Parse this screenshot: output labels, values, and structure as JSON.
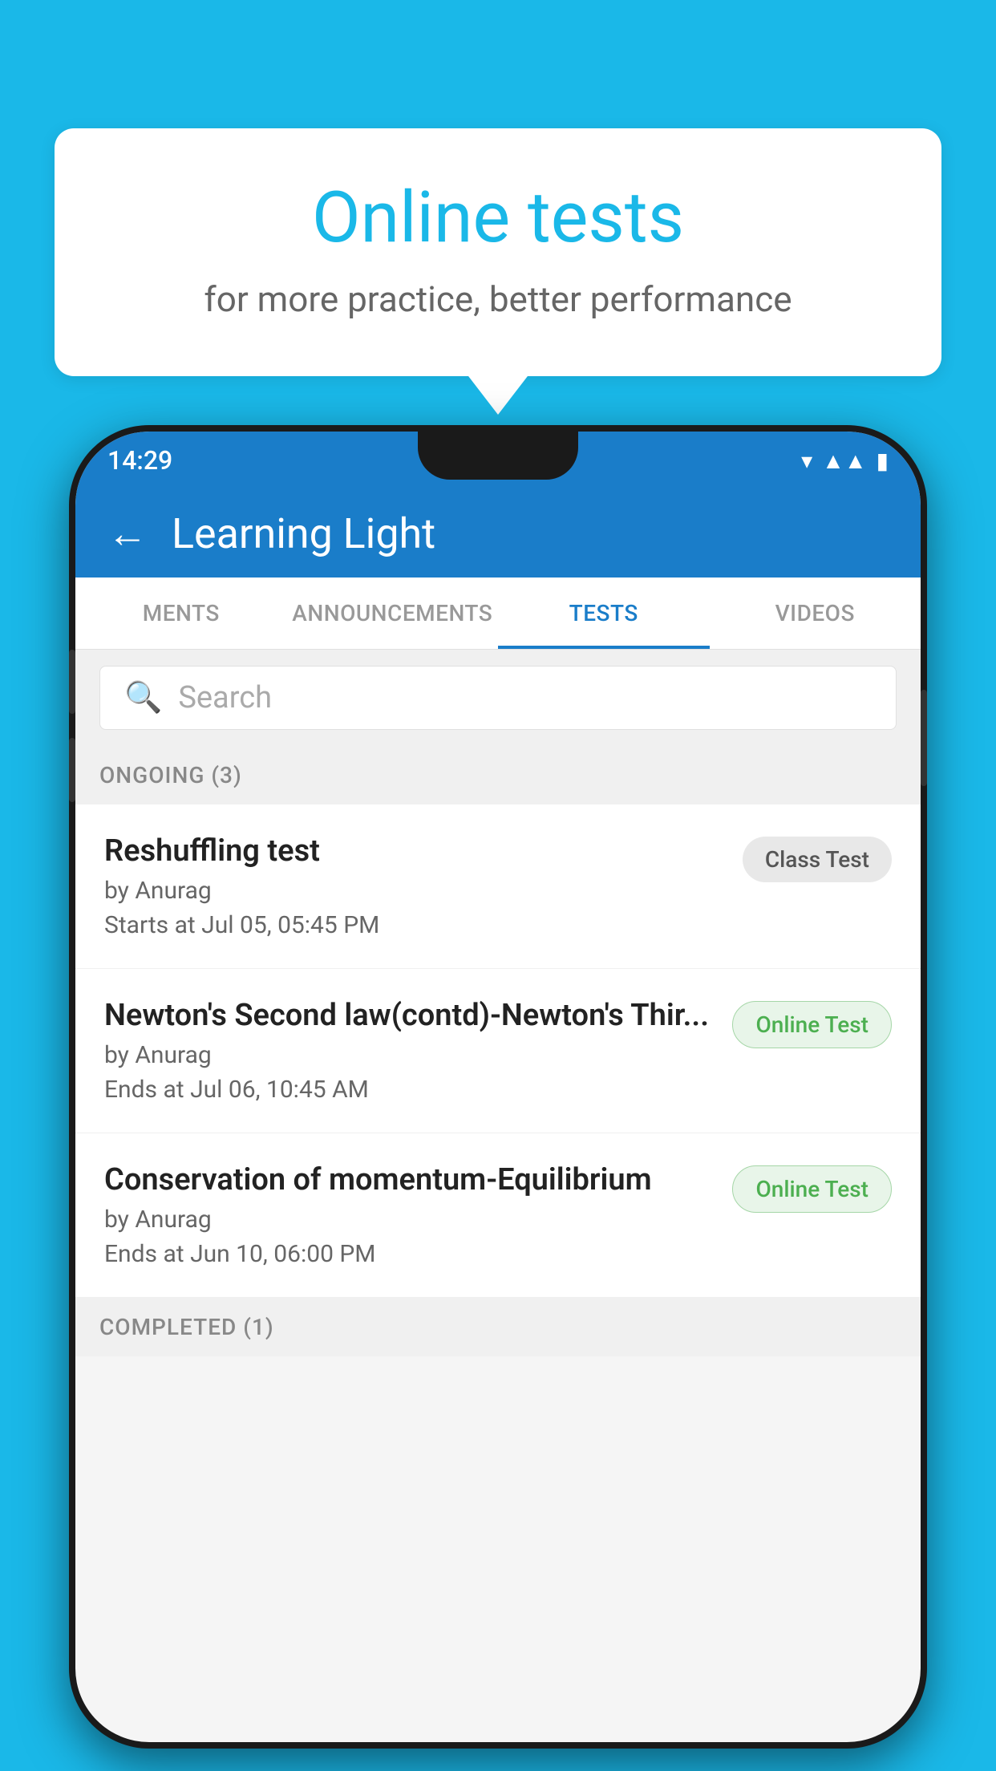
{
  "background_color": "#1ab8e8",
  "bubble": {
    "title": "Online tests",
    "subtitle": "for more practice, better performance"
  },
  "phone": {
    "status": {
      "time": "14:29",
      "icons": [
        "wifi",
        "signal",
        "battery"
      ]
    },
    "header": {
      "back_label": "←",
      "title": "Learning Light"
    },
    "tabs": [
      {
        "label": "MENTS",
        "active": false
      },
      {
        "label": "ANNOUNCEMENTS",
        "active": false
      },
      {
        "label": "TESTS",
        "active": true
      },
      {
        "label": "VIDEOS",
        "active": false
      }
    ],
    "search": {
      "placeholder": "Search"
    },
    "sections": [
      {
        "title": "ONGOING (3)",
        "tests": [
          {
            "name": "Reshuffling test",
            "by": "by Anurag",
            "time_label": "Starts at",
            "time": "Jul 05, 05:45 PM",
            "badge": "Class Test",
            "badge_type": "class"
          },
          {
            "name": "Newton's Second law(contd)-Newton's Thir...",
            "by": "by Anurag",
            "time_label": "Ends at",
            "time": "Jul 06, 10:45 AM",
            "badge": "Online Test",
            "badge_type": "online"
          },
          {
            "name": "Conservation of momentum-Equilibrium",
            "by": "by Anurag",
            "time_label": "Ends at",
            "time": "Jun 10, 06:00 PM",
            "badge": "Online Test",
            "badge_type": "online"
          }
        ]
      }
    ],
    "completed_label": "COMPLETED (1)"
  }
}
